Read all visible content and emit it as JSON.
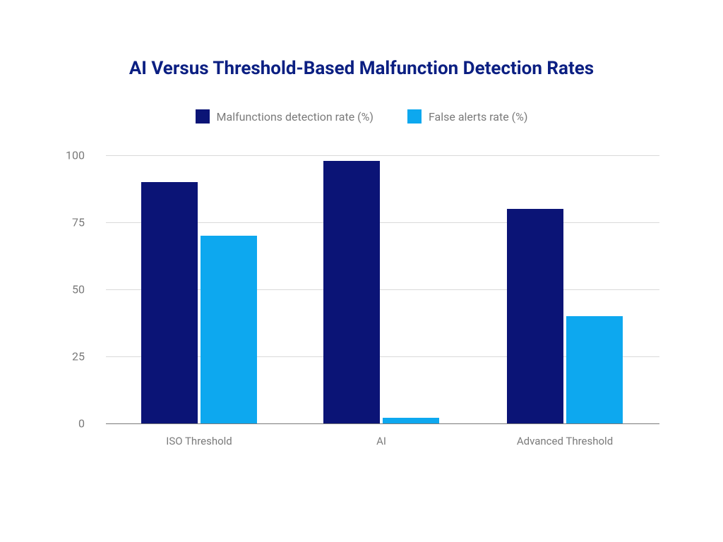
{
  "chart_data": {
    "type": "bar",
    "title": "AI Versus Threshold-Based Malfunction Detection Rates",
    "categories": [
      "ISO Threshold",
      "AI",
      "Advanced Threshold"
    ],
    "series": [
      {
        "name": "Malfunctions detection rate (%)",
        "values": [
          90,
          98,
          80
        ],
        "color": "#0b1476"
      },
      {
        "name": "False alerts rate (%)",
        "values": [
          70,
          2,
          40
        ],
        "color": "#0da8ef"
      }
    ],
    "ylim": [
      0,
      100
    ],
    "yticks": [
      0,
      25,
      50,
      75,
      100
    ],
    "xlabel": "",
    "ylabel": ""
  }
}
